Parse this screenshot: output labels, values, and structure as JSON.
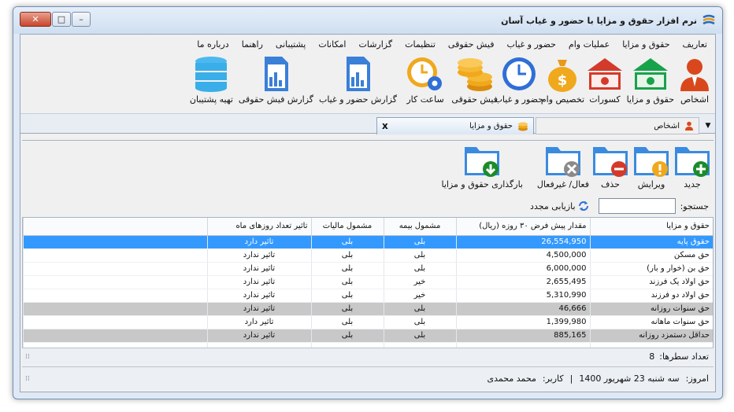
{
  "window": {
    "title": "نرم افزار حقوق و مزایا با حضور و غیاب آسان",
    "close_glyph": "✕",
    "max_glyph": "□",
    "min_glyph": "–"
  },
  "menu": [
    "تعاریف",
    "حقوق و مزایا",
    "عملیات وام",
    "حضور و غیاب",
    "فیش حقوقی",
    "تنظیمات",
    "گزارشات",
    "امکانات",
    "پشتیبانی",
    "راهنما",
    "درباره ما"
  ],
  "ribbon": {
    "persons": "اشخاص",
    "salary": "حقوق و مزایا",
    "deductions": "کسورات",
    "loan": "تخصیص وام",
    "attendance": "حضور و غیاب",
    "payslip": "فیش حقوقی",
    "worktime": "ساعت کار",
    "attendance_report": "گزارش حضور و غیاب",
    "payslip_report": "گزارش فیش حقوقی",
    "backup": "تهیه پشتیبان"
  },
  "tabs": {
    "active": "حقوق و مزایا",
    "inactive": "اشخاص",
    "close_glyph": "x"
  },
  "toolbar": {
    "new": "جدید",
    "edit": "ویرایش",
    "delete": "حذف",
    "toggle": "فعال/ غیرفعال",
    "reload": "بارگذاری حقوق و مزایا"
  },
  "search": {
    "label": "جستجو:",
    "value": "",
    "refresh_label": "بازیابی مجدد"
  },
  "table": {
    "headers": [
      "حقوق و مزایا",
      "مقدار پیش فرض ۳۰ روزه (ریال)",
      "مشمول بیمه",
      "مشمول مالیات",
      "تاثیر تعداد روزهای ماه"
    ],
    "rows": [
      {
        "name": "حقوق پایه",
        "amount": "26,554,950",
        "insurance": "بلی",
        "tax": "بلی",
        "effect": "تاثیر دارد",
        "style": "sel"
      },
      {
        "name": "حق مسکن",
        "amount": "4,500,000",
        "insurance": "بلی",
        "tax": "بلی",
        "effect": "تاثیر ندارد",
        "style": ""
      },
      {
        "name": "حق بن (خوار و بار)",
        "amount": "6,000,000",
        "insurance": "بلی",
        "tax": "بلی",
        "effect": "تاثیر ندارد",
        "style": ""
      },
      {
        "name": "حق اولاد یک فرزند",
        "amount": "2,655,495",
        "insurance": "خیر",
        "tax": "بلی",
        "effect": "تاثیر ندارد",
        "style": ""
      },
      {
        "name": "حق اولاد دو فرزند",
        "amount": "5,310,990",
        "insurance": "خیر",
        "tax": "بلی",
        "effect": "تاثیر ندارد",
        "style": ""
      },
      {
        "name": "حق سنوات روزانه",
        "amount": "46,666",
        "insurance": "بلی",
        "tax": "بلی",
        "effect": "تاثیر ندارد",
        "style": "gray"
      },
      {
        "name": "حق سنوات ماهانه",
        "amount": "1,399,980",
        "insurance": "بلی",
        "tax": "بلی",
        "effect": "تاثیر دارد",
        "style": ""
      },
      {
        "name": "حداقل دستمزد روزانه",
        "amount": "885,165",
        "insurance": "بلی",
        "tax": "بلی",
        "effect": "تاثیر ندارد",
        "style": "gray"
      }
    ]
  },
  "status": {
    "row_count_label": "تعداد سطرها:",
    "row_count": "8",
    "today_label": "امروز:",
    "today": "سه شنبه 23 شهریور 1400",
    "separator": "|",
    "user_label": "کاربر:",
    "user": "محمد محمدی"
  },
  "colors": {
    "selection": "#3399ff",
    "gray_row": "#c8c8c8",
    "folder": "#3a8be0"
  }
}
